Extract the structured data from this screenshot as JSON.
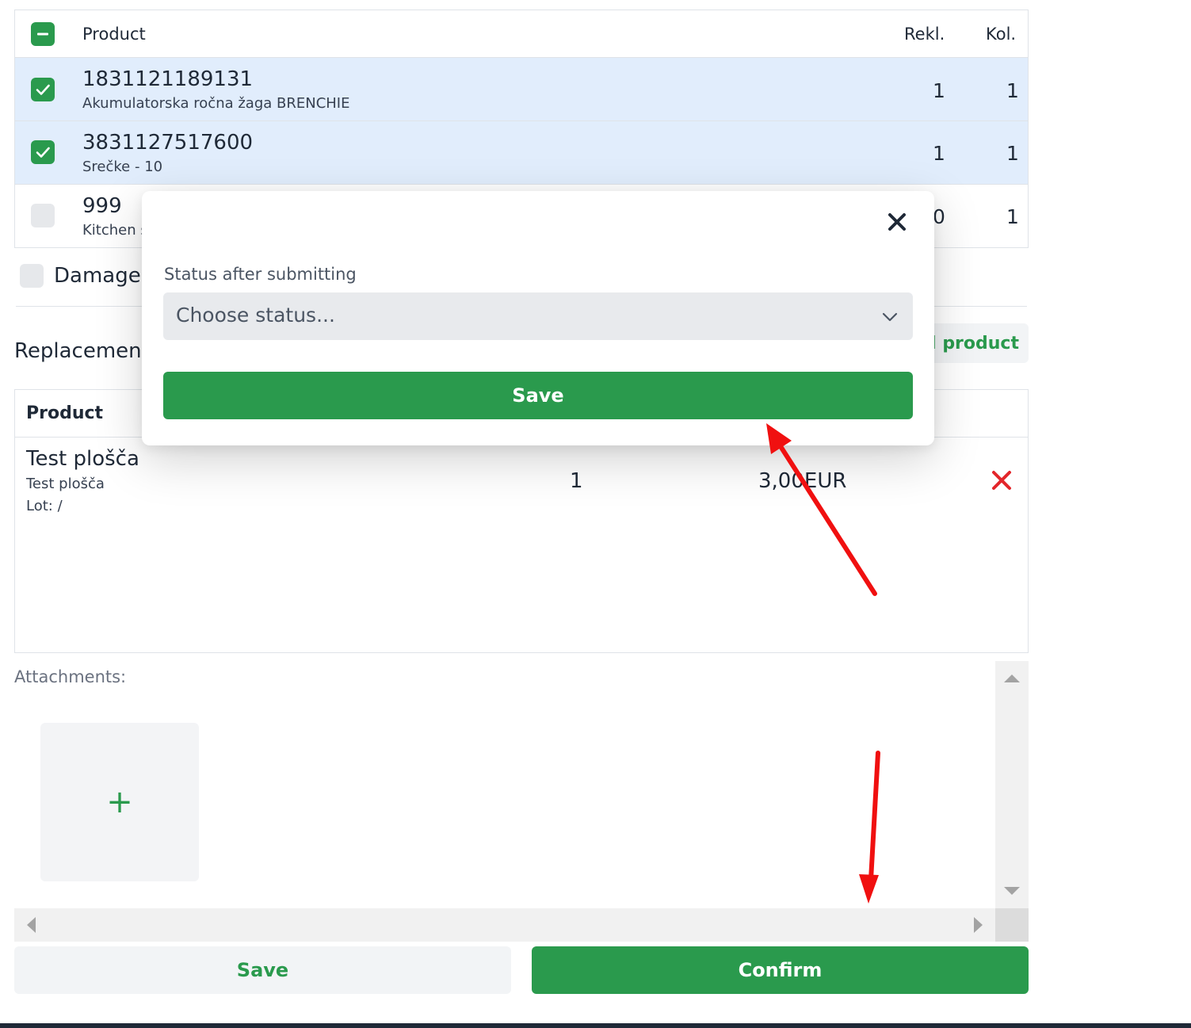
{
  "products_table": {
    "header": {
      "product": "Product",
      "rekl": "Rekl.",
      "kol": "Kol."
    },
    "rows": [
      {
        "code": "1831121189131",
        "name": "Akumulatorska ročna žaga BRENCHIE",
        "rekl": "1",
        "kol": "1",
        "checked": true
      },
      {
        "code": "3831127517600",
        "name": "Srečke - 10",
        "rekl": "1",
        "kol": "1",
        "checked": true
      },
      {
        "code": "999",
        "name": "Kitchen s",
        "rekl": "0",
        "kol": "1",
        "checked": false
      }
    ]
  },
  "damaged": {
    "label": "Damaged"
  },
  "replacements": {
    "title": "Replacements",
    "add_button": "d product",
    "header_product": "Product",
    "items": [
      {
        "name": "Test plošča",
        "subtitle": "Test plošča",
        "lot": "Lot: /",
        "qty": "1",
        "price": "3,00EUR"
      }
    ]
  },
  "attachments": {
    "label": "Attachments:",
    "add_symbol": "+"
  },
  "buttons": {
    "save": "Save",
    "confirm": "Confirm"
  },
  "modal": {
    "status_label": "Status after submitting",
    "select_placeholder": "Choose status...",
    "save": "Save"
  },
  "colors": {
    "primary_green": "#2a9a4d",
    "selected_row": "#e1edfc",
    "annotation_red": "#f01010",
    "remove_red": "#e3262b"
  }
}
